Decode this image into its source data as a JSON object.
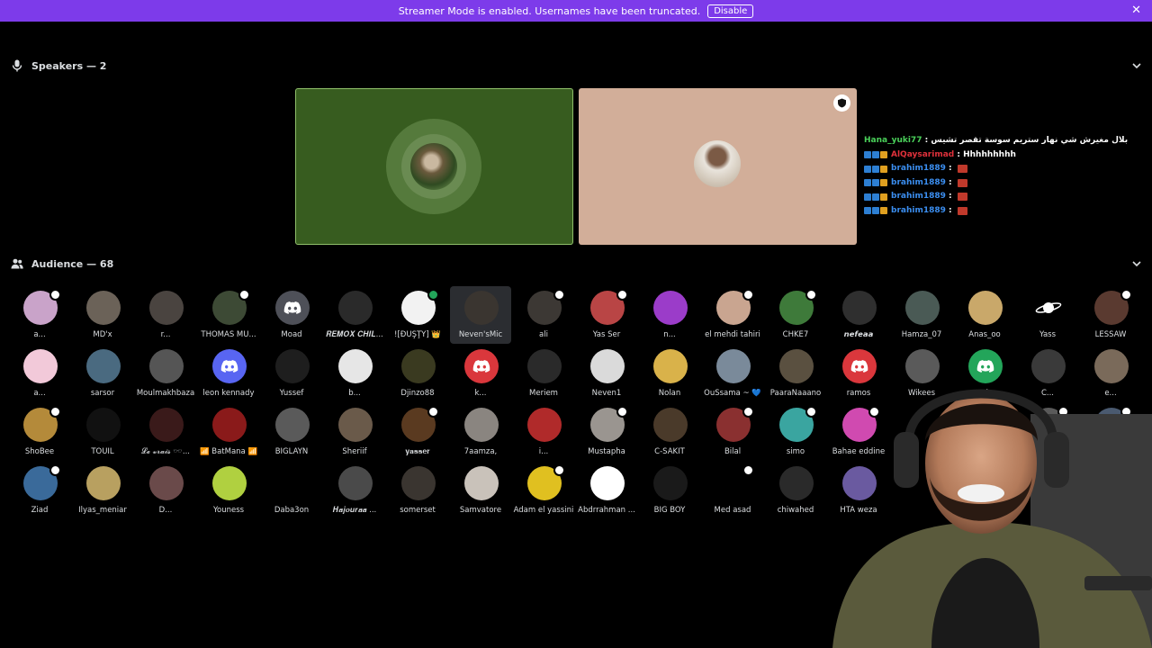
{
  "banner": {
    "text": "Streamer Mode is enabled. Usernames have been truncated.",
    "button_label": "Disable",
    "close_glyph": "✕"
  },
  "speakers": {
    "label": "Speakers — 2",
    "icon": "microphone-icon"
  },
  "audience": {
    "label": "Audience — 68",
    "icon": "users-icon"
  },
  "chat": [
    {
      "user": "Hana_yuki77",
      "user_color": "#4ad15a",
      "message": "بلال مغيرش شي نهار ستريم سوسة تقصر تشيس",
      "emote": false
    },
    {
      "user": "AlQaysarimad",
      "user_color": "#e0313b",
      "message": "Hhhhhhhhh",
      "emote": false
    },
    {
      "user": "brahim1889",
      "user_color": "#3b8ef0",
      "message": "",
      "emote": true
    },
    {
      "user": "brahim1889",
      "user_color": "#3b8ef0",
      "message": "",
      "emote": true
    },
    {
      "user": "brahim1889",
      "user_color": "#3b8ef0",
      "message": "",
      "emote": true
    },
    {
      "user": "brahim1889",
      "user_color": "#3b8ef0",
      "message": "",
      "emote": true
    }
  ],
  "members": [
    {
      "name": "a...",
      "color": "#c9a3c9",
      "badge": "white"
    },
    {
      "name": "MD'x",
      "color": "#6b6258",
      "badge": ""
    },
    {
      "name": "r...",
      "color": "#4a4440",
      "badge": ""
    },
    {
      "name": "THOMAS MÜ...",
      "color": "#3d4a35",
      "badge": "white"
    },
    {
      "name": "Moad",
      "color": "#5865f2",
      "badge": "",
      "discord": true,
      "dcolor": "#4e5058"
    },
    {
      "name": "𝑹𝑬𝑴𝑶𝑿 𝑪𝑯𝑰𝑳...",
      "color": "#2a2a2a",
      "badge": ""
    },
    {
      "name": "![ĐŪŞŢŸ] 👑",
      "color": "#f2f2f2",
      "badge": "green"
    },
    {
      "name": "Neven'sMic",
      "color": "#3a3530",
      "badge": "",
      "hover": true
    },
    {
      "name": "ali",
      "color": "#3c3834",
      "badge": "white"
    },
    {
      "name": "Yas Ser",
      "color": "#b94545",
      "badge": "white"
    },
    {
      "name": "n...",
      "color": "#9b3cc9",
      "badge": ""
    },
    {
      "name": "el mehdi tahiri",
      "color": "#c9a590",
      "badge": "white"
    },
    {
      "name": "CHKE7",
      "color": "#3e7a3a",
      "badge": "white"
    },
    {
      "name": "𝙣𝙚𝙛𝙚𝙖𝙖",
      "color": "#2f2f2f",
      "badge": ""
    },
    {
      "name": "Hamza_07",
      "color": "#4a5a55",
      "badge": ""
    },
    {
      "name": "Anas_oo",
      "color": "#c9a86a",
      "badge": ""
    },
    {
      "name": "Yass",
      "color": "#000000",
      "badge": "",
      "planet": true
    },
    {
      "name": "LESSAW",
      "color": "#5a3a30",
      "badge": "white"
    },
    {
      "name": "a...",
      "color": "#f2c9d9",
      "badge": ""
    },
    {
      "name": "sarsor",
      "color": "#4a6a80",
      "badge": ""
    },
    {
      "name": "Moulmakhbaza",
      "color": "#555555",
      "badge": ""
    },
    {
      "name": "leon kennady",
      "color": "#5865f2",
      "badge": "",
      "discord": true,
      "dcolor": "#5865f2"
    },
    {
      "name": "Yussef",
      "color": "#1e1e1e",
      "badge": ""
    },
    {
      "name": "b...",
      "color": "#e6e6e6",
      "badge": ""
    },
    {
      "name": "Djinzo88",
      "color": "#3a3a20",
      "badge": ""
    },
    {
      "name": "k...",
      "color": "#da373c",
      "badge": "",
      "discord": true,
      "dcolor": "#da373c"
    },
    {
      "name": "Meriem",
      "color": "#2a2a2a",
      "badge": ""
    },
    {
      "name": "Neven1",
      "color": "#dadada",
      "badge": ""
    },
    {
      "name": "Nolan",
      "color": "#d9b24a",
      "badge": ""
    },
    {
      "name": "OuSsama ~ 💙",
      "color": "#7a8a9a",
      "badge": ""
    },
    {
      "name": "PaaraNaaano",
      "color": "#5a5040",
      "badge": ""
    },
    {
      "name": "ramos",
      "color": "#da373c",
      "badge": "",
      "discord": true,
      "dcolor": "#da373c"
    },
    {
      "name": "Wikees",
      "color": "#5a5a5a",
      "badge": ""
    },
    {
      "name": "...k",
      "color": "#23a55a",
      "badge": "",
      "discord": true,
      "dcolor": "#23a55a"
    },
    {
      "name": "C...",
      "color": "#3a3a3a",
      "badge": ""
    },
    {
      "name": "e...",
      "color": "#7a6a5a",
      "badge": ""
    },
    {
      "name": "ShoBee",
      "color": "#b48a3a",
      "badge": "white"
    },
    {
      "name": "TOUIL",
      "color": "#111111",
      "badge": ""
    },
    {
      "name": "𝓛𝓮 𝓿𝓻𝓪𝓲𝓼 🕶️...",
      "color": "#3a1a1a",
      "badge": ""
    },
    {
      "name": "📶 BatMana 📶",
      "color": "#8a1a1a",
      "badge": ""
    },
    {
      "name": "BIGLAYN",
      "color": "#5a5a5a",
      "badge": ""
    },
    {
      "name": "Sheriif",
      "color": "#6a5a4a",
      "badge": ""
    },
    {
      "name": "𝐲𝐚𝐬𝐬𝐞𝐫",
      "color": "#5a3a20",
      "badge": "white"
    },
    {
      "name": "7aamza,",
      "color": "#8a8580",
      "badge": ""
    },
    {
      "name": "i...",
      "color": "#b02a2a",
      "badge": ""
    },
    {
      "name": "Mustapha",
      "color": "#9a9590",
      "badge": "white"
    },
    {
      "name": "C-SAKIT",
      "color": "#4a3a2a",
      "badge": ""
    },
    {
      "name": "Bilal",
      "color": "#8a3030",
      "badge": "white"
    },
    {
      "name": "simo",
      "color": "#3aa5a0",
      "badge": "white"
    },
    {
      "name": "Bahae eddine",
      "color": "#d04ab0",
      "badge": "white"
    },
    {
      "name": "",
      "color": "#000000",
      "badge": ""
    },
    {
      "name": "",
      "color": "#000000",
      "badge": ""
    },
    {
      "name": "",
      "color": "#5a5a5a",
      "badge": "white"
    },
    {
      "name": "",
      "color": "#4a5a70",
      "badge": "white"
    },
    {
      "name": "Ziad",
      "color": "#3a6a9a",
      "badge": "white"
    },
    {
      "name": "Ilyas_meniar",
      "color": "#b8a060",
      "badge": ""
    },
    {
      "name": "D...",
      "color": "#6a4a4a",
      "badge": ""
    },
    {
      "name": "Youness",
      "color": "#b0d040",
      "badge": ""
    },
    {
      "name": "Daba3on",
      "color": "#000000",
      "badge": ""
    },
    {
      "name": "𝑯𝒂𝒋𝒐𝒖𝒓𝒂𝒂 ...",
      "color": "#4a4a4a",
      "badge": ""
    },
    {
      "name": "somerset",
      "color": "#3a3530",
      "badge": ""
    },
    {
      "name": "Samvatore",
      "color": "#c9c2ba",
      "badge": ""
    },
    {
      "name": "Adam el yassini",
      "color": "#e0c020",
      "badge": "white"
    },
    {
      "name": "Abdrrahman ...",
      "color": "#ffffff",
      "badge": ""
    },
    {
      "name": "BIG BOY",
      "color": "#1a1a1a",
      "badge": ""
    },
    {
      "name": "Med asad",
      "color": "#000000",
      "badge": "white"
    },
    {
      "name": "chiwahed",
      "color": "#2a2a2a",
      "badge": ""
    },
    {
      "name": "HTA weza",
      "color": "#6a5aa0",
      "badge": ""
    }
  ]
}
